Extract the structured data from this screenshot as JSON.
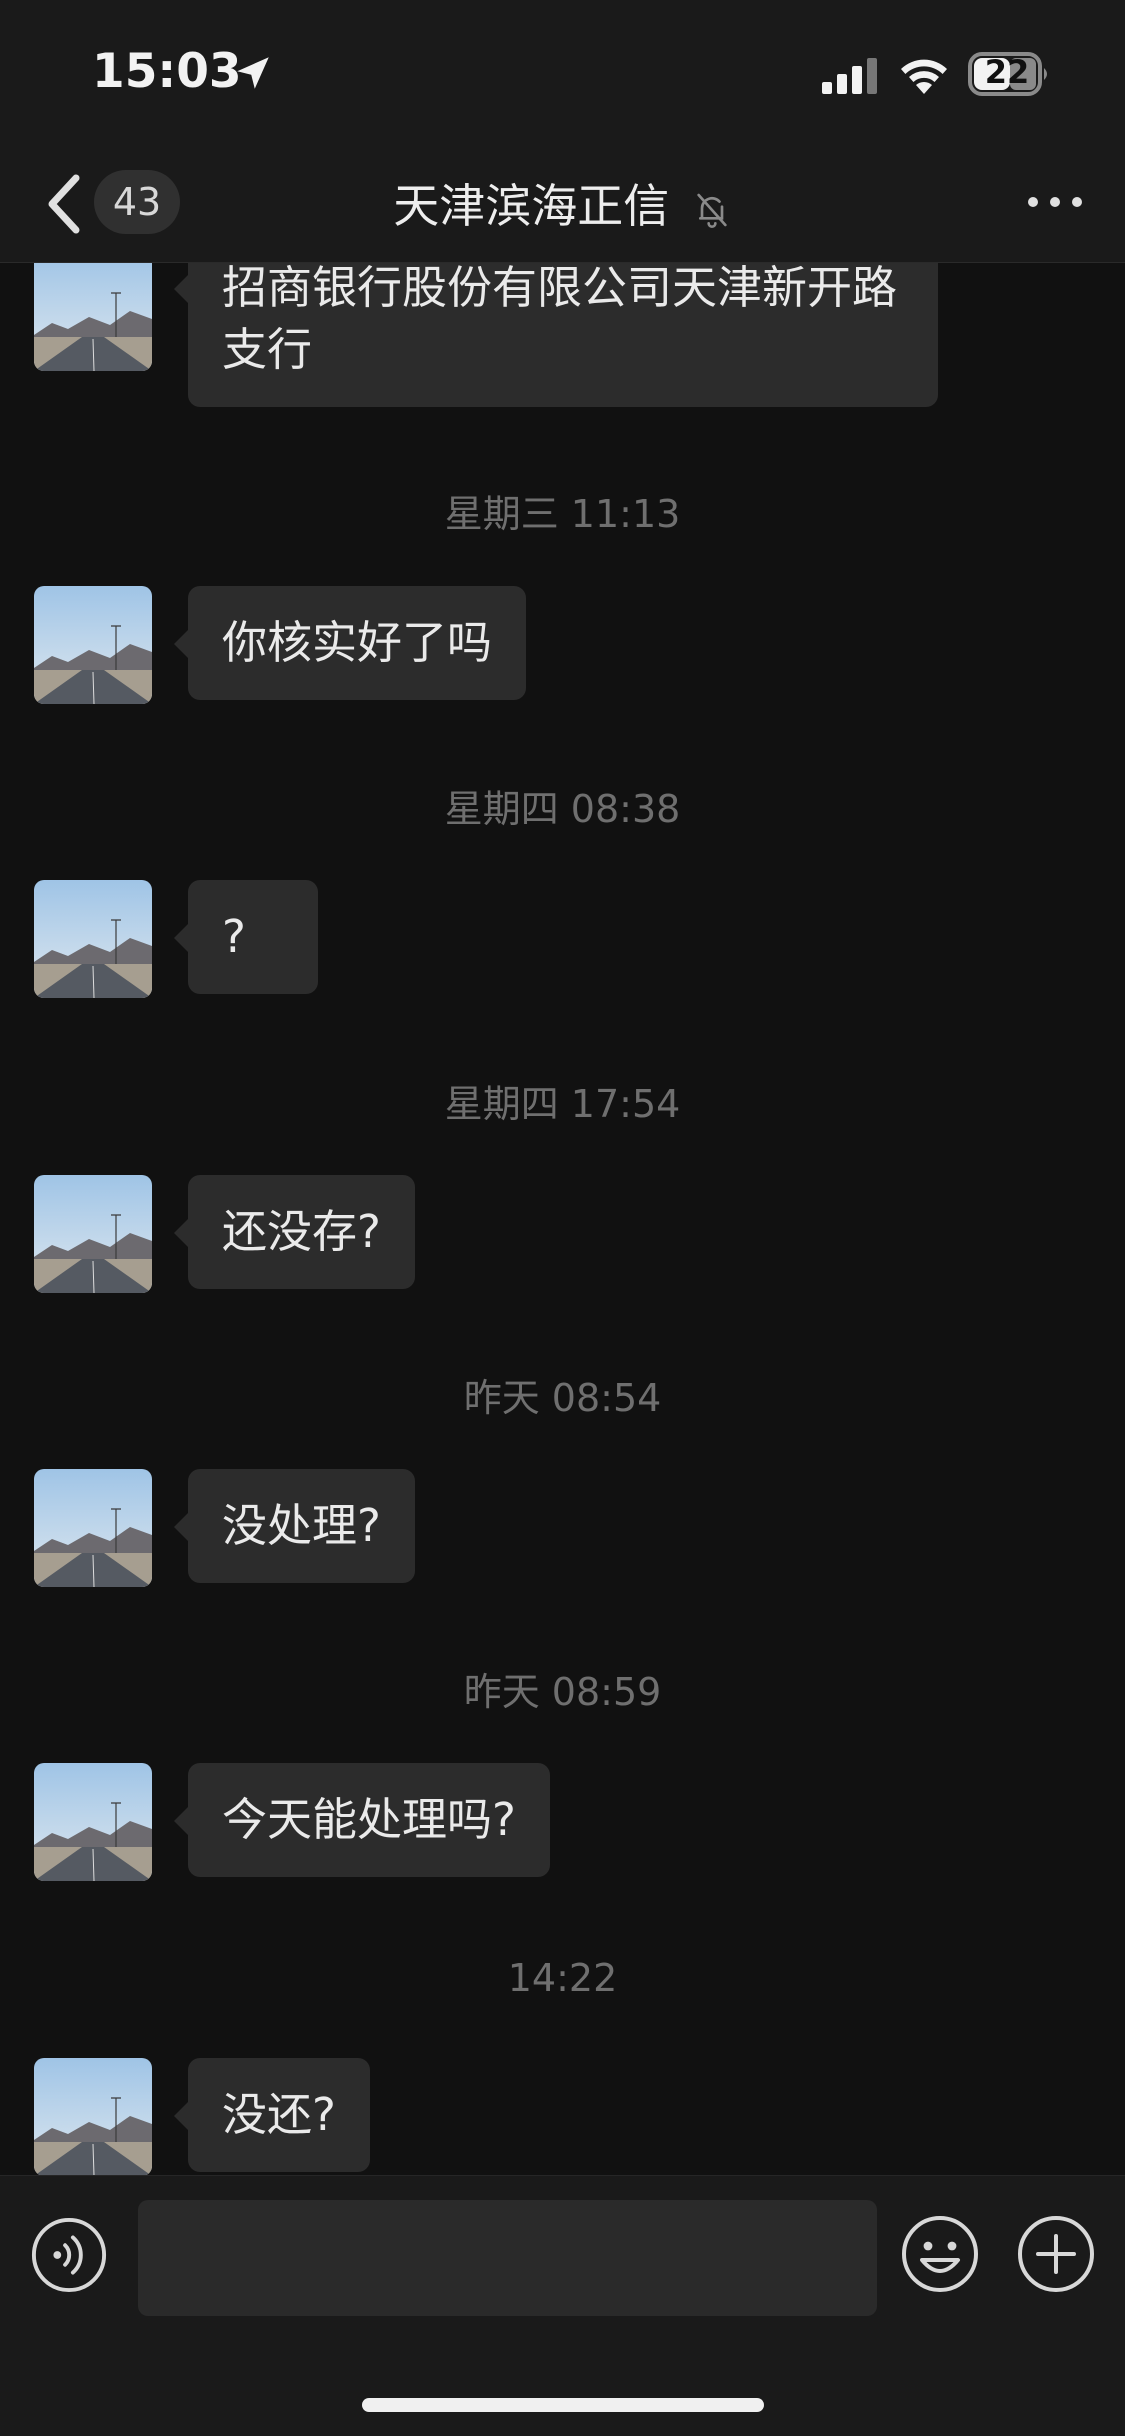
{
  "status_bar": {
    "time": "15:03",
    "battery": "22",
    "icons": [
      "location-arrow-icon",
      "cellular-signal-icon",
      "wifi-icon",
      "battery-icon"
    ]
  },
  "header": {
    "back_icon": "chevron-left-icon",
    "unread_count": "43",
    "title": "天津滨海正信",
    "mute_icon": "bell-slash-icon",
    "more_icon": "ellipsis-icon"
  },
  "messages": [
    {
      "type": "text",
      "text": "招商银行股份有限公司天津新开路支行"
    },
    {
      "type": "time",
      "text": "星期三 11:13"
    },
    {
      "type": "text",
      "text": "你核实好了吗"
    },
    {
      "type": "time",
      "text": "星期四 08:38"
    },
    {
      "type": "text",
      "text": "?"
    },
    {
      "type": "time",
      "text": "星期四 17:54"
    },
    {
      "type": "text",
      "text": "还没存?"
    },
    {
      "type": "time",
      "text": "昨天 08:54"
    },
    {
      "type": "text",
      "text": "没处理?"
    },
    {
      "type": "time",
      "text": "昨天 08:59"
    },
    {
      "type": "text",
      "text": "今天能处理吗?"
    },
    {
      "type": "time",
      "text": "14:22"
    },
    {
      "type": "text",
      "text": "没还?"
    }
  ],
  "input_bar": {
    "voice_icon": "voice-icon",
    "emoji_icon": "smiley-icon",
    "plus_icon": "plus-icon",
    "input_value": ""
  },
  "colors": {
    "background": "#111111",
    "bars": "#1a1a1a",
    "bubble": "#2c2c2c",
    "text": "#eaeaea",
    "timestamp": "#6f6f6f"
  }
}
